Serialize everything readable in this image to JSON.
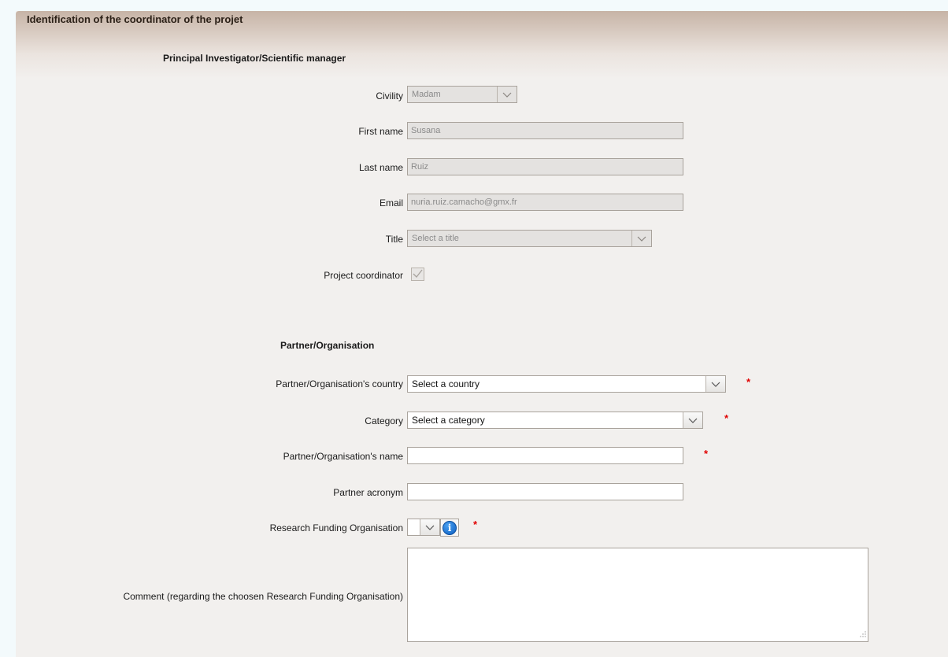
{
  "panel": {
    "title": "Identification of the coordinator of the projet"
  },
  "investigator": {
    "section_title": "Principal Investigator/Scientific manager",
    "civility": {
      "label": "Civility",
      "value": "Madam"
    },
    "first_name": {
      "label": "First name",
      "value": "Susana"
    },
    "last_name": {
      "label": "Last name",
      "value": "Ruiz"
    },
    "email": {
      "label": "Email",
      "value": "nuria.ruiz.camacho@gmx.fr"
    },
    "title": {
      "label": "Title",
      "value": "Select a title"
    },
    "project_coordinator": {
      "label": "Project coordinator",
      "checked": true
    }
  },
  "partner": {
    "section_title": "Partner/Organisation",
    "country": {
      "label": "Partner/Organisation's country",
      "value": "Select a country"
    },
    "category": {
      "label": "Category",
      "value": "Select a category"
    },
    "name": {
      "label": "Partner/Organisation's name",
      "value": ""
    },
    "acronym": {
      "label": "Partner acronym",
      "value": ""
    },
    "funding_org": {
      "label": "Research Funding Organisation",
      "value": ""
    },
    "comment": {
      "label": "Comment (regarding the choosen Research Funding Organisation)",
      "value": ""
    },
    "required_mark": "*"
  },
  "icons": {
    "dropdown": "chevron-down-icon",
    "checkbox": "checkmark-icon",
    "info": "info-icon",
    "resize": "resize-grip-icon"
  },
  "colors": {
    "header_gradient_top": "#c7b4a6",
    "panel_background": "#f2f0ee",
    "required": "#e00000",
    "info_blue": "#0d5fc2"
  }
}
